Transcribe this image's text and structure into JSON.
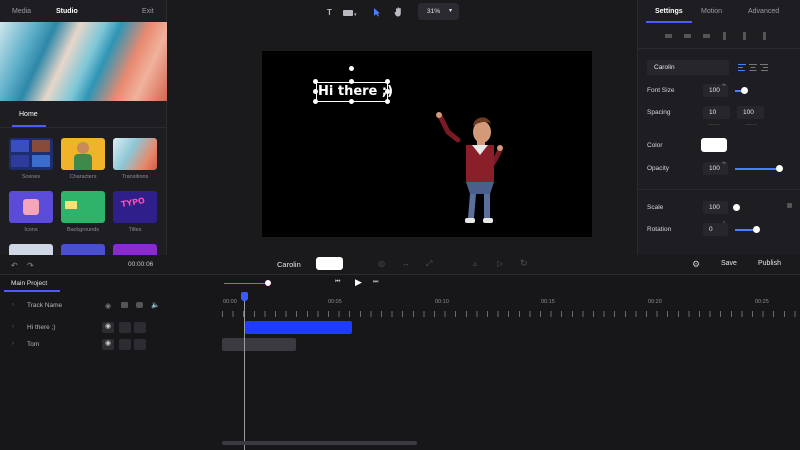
{
  "left_panel": {
    "tabs": [
      "Media",
      "Studio",
      "Exit"
    ],
    "section_tab": "Home",
    "templates": [
      {
        "label": "Scenes",
        "color": "#2c3a8a"
      },
      {
        "label": "Characters",
        "color": "#f1b32a"
      },
      {
        "label": "Transitions",
        "color": "#b9dde6"
      },
      {
        "label": "Icons",
        "color": "#5a4bd8"
      },
      {
        "label": "Backgrounds",
        "color": "#2fb36b"
      },
      {
        "label": "Titles",
        "color": "#3a2aa8"
      }
    ]
  },
  "toolbar": {
    "text_tool": "T",
    "zoom": "31%"
  },
  "canvas": {
    "text": "Hi there ;)"
  },
  "right_panel": {
    "tabs": [
      "Settings",
      "Motion",
      "Advanced"
    ],
    "font": "Carolin",
    "font_size_label": "Font Size",
    "font_size": "100",
    "spacing_label": "Spacing",
    "spacing_letter": "10",
    "spacing_line": "100",
    "color_label": "Color",
    "opacity_label": "Opacity",
    "opacity": "100",
    "scale_label": "Scale",
    "scale": "100",
    "rotation_label": "Rotation",
    "rotation": "0",
    "font_size_unit": "%",
    "opacity_unit": "%",
    "rotation_unit": "°"
  },
  "midbar": {
    "time": "00:00:06",
    "font": "Carolin",
    "save": "Save",
    "publish": "Publish"
  },
  "timeline": {
    "project_tab": "Main Project",
    "ruler": [
      "00:00",
      "00:05",
      "00:10",
      "00:15",
      "00:20",
      "00:25"
    ],
    "tracks": [
      "Track Name",
      "Hi there ;)",
      "Tom"
    ]
  },
  "colors": {
    "accent": "#4a5cff",
    "clip_blue": "#1f3bff",
    "clip_gray": "#3a3a40"
  }
}
